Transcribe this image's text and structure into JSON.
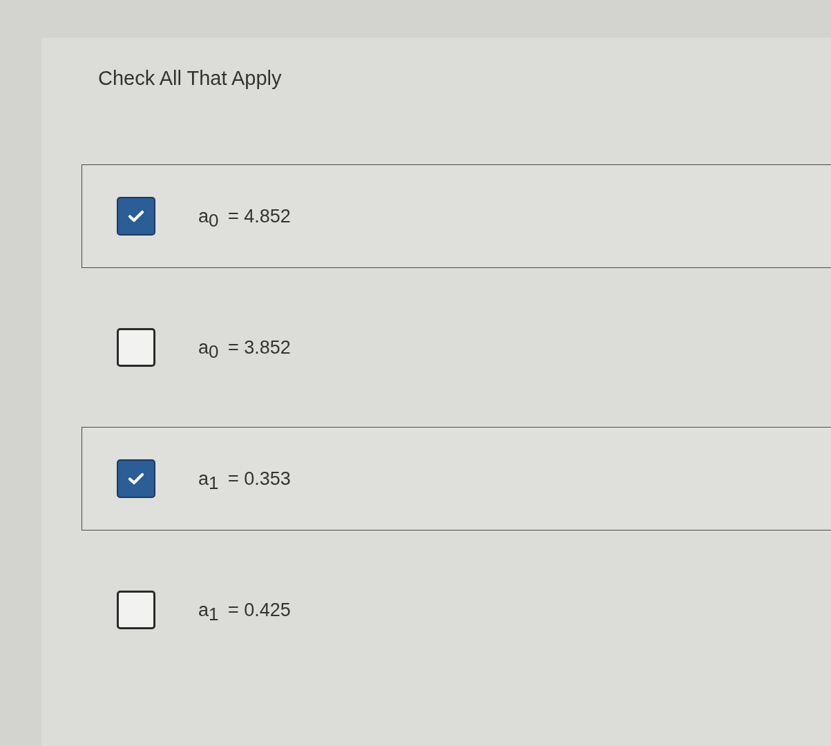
{
  "title": "Check All That Apply",
  "options": [
    {
      "label": "a$_{0}$ = 4.852",
      "checked": true
    },
    {
      "label": "a$_{0}$ = 3.852",
      "checked": false
    },
    {
      "label": "a$_{1}$ = 0.353",
      "checked": true
    },
    {
      "label": "a$_{1}$ = 0.425",
      "checked": false
    }
  ]
}
